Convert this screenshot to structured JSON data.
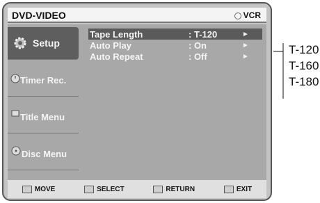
{
  "header": {
    "title": "DVD-VIDEO",
    "mode": "VCR"
  },
  "sidebar": {
    "items": [
      {
        "label": "Setup",
        "icon": "gear-icon"
      },
      {
        "label": "Timer Rec.",
        "icon": "clock-icon"
      },
      {
        "label": "Title Menu",
        "icon": "title-menu-icon"
      },
      {
        "label": "Disc Menu",
        "icon": "disc-icon"
      }
    ]
  },
  "menu": {
    "rows": [
      {
        "name": "Tape Length",
        "value": ": T-120",
        "arrow": "►"
      },
      {
        "name": "Auto Play",
        "value": ": On",
        "arrow": "►"
      },
      {
        "name": "Auto Repeat",
        "value": ": Off",
        "arrow": "►"
      }
    ]
  },
  "footer": {
    "move": "MOVE",
    "select": "SELECT",
    "return": "RETURN",
    "exit": "EXIT"
  },
  "callout": {
    "options": [
      "T-120",
      "T-160",
      "T-180"
    ]
  }
}
